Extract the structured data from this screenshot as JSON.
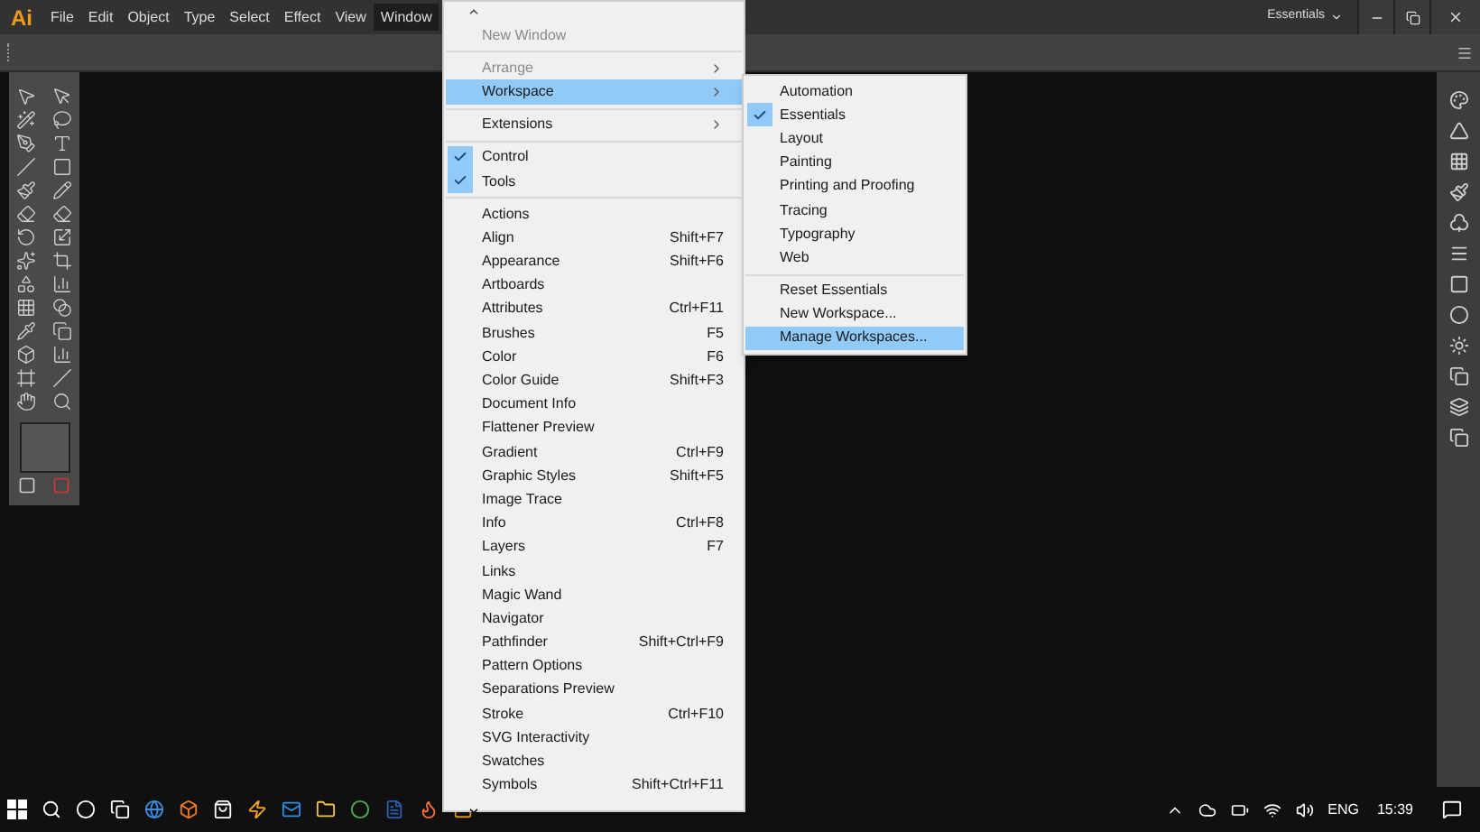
{
  "menubar": {
    "logo": "Ai",
    "menus": [
      {
        "label": "File",
        "selected": false
      },
      {
        "label": "Edit",
        "selected": false
      },
      {
        "label": "Object",
        "selected": false
      },
      {
        "label": "Type",
        "selected": false
      },
      {
        "label": "Select",
        "selected": false
      },
      {
        "label": "Effect",
        "selected": false
      },
      {
        "label": "View",
        "selected": false
      },
      {
        "label": "Window",
        "selected": true
      }
    ],
    "workspace": "Essentials"
  },
  "window_menu": {
    "sections": [
      [
        {
          "label": "New Window",
          "checked": false,
          "selected": false,
          "disabled": true,
          "submenu": false
        }
      ],
      [
        {
          "label": "Arrange",
          "checked": false,
          "selected": false,
          "disabled": true,
          "submenu": true
        },
        {
          "label": "Workspace",
          "checked": false,
          "selected": true,
          "disabled": false,
          "submenu": true
        }
      ],
      [
        {
          "label": "Extensions",
          "checked": false,
          "selected": false,
          "disabled": false,
          "submenu": true
        }
      ],
      [
        {
          "label": "Control",
          "checked": true,
          "selected": false,
          "disabled": false,
          "submenu": false
        },
        {
          "label": "Tools",
          "checked": true,
          "selected": false,
          "disabled": false,
          "submenu": false
        }
      ],
      [
        {
          "label": "Actions",
          "checked": false,
          "selected": false,
          "disabled": false,
          "submenu": false
        },
        {
          "label": "Align",
          "shortcut": "Shift+F7",
          "checked": false,
          "selected": false,
          "disabled": false,
          "submenu": false
        },
        {
          "label": "Appearance",
          "shortcut": "Shift+F6",
          "checked": false,
          "selected": false,
          "disabled": false,
          "submenu": false
        },
        {
          "label": "Artboards",
          "checked": false,
          "selected": false,
          "disabled": false,
          "submenu": false
        },
        {
          "label": "Attributes",
          "shortcut": "Ctrl+F11",
          "checked": false,
          "selected": false,
          "disabled": false,
          "submenu": false
        },
        {
          "label": "Brushes",
          "shortcut": "F5",
          "checked": false,
          "selected": false,
          "disabled": false,
          "submenu": false
        },
        {
          "label": "Color",
          "shortcut": "F6",
          "checked": false,
          "selected": false,
          "disabled": false,
          "submenu": false
        },
        {
          "label": "Color Guide",
          "shortcut": "Shift+F3",
          "checked": false,
          "selected": false,
          "disabled": false,
          "submenu": false
        },
        {
          "label": "Document Info",
          "checked": false,
          "selected": false,
          "disabled": false,
          "submenu": false
        },
        {
          "label": "Flattener Preview",
          "checked": false,
          "selected": false,
          "disabled": false,
          "submenu": false
        },
        {
          "label": "Gradient",
          "shortcut": "Ctrl+F9",
          "checked": false,
          "selected": false,
          "disabled": false,
          "submenu": false
        },
        {
          "label": "Graphic Styles",
          "shortcut": "Shift+F5",
          "checked": false,
          "selected": false,
          "disabled": false,
          "submenu": false
        },
        {
          "label": "Image Trace",
          "checked": false,
          "selected": false,
          "disabled": false,
          "submenu": false
        },
        {
          "label": "Info",
          "shortcut": "Ctrl+F8",
          "checked": false,
          "selected": false,
          "disabled": false,
          "submenu": false
        },
        {
          "label": "Layers",
          "shortcut": "F7",
          "checked": false,
          "selected": false,
          "disabled": false,
          "submenu": false
        },
        {
          "label": "Links",
          "checked": false,
          "selected": false,
          "disabled": false,
          "submenu": false
        },
        {
          "label": "Magic Wand",
          "checked": false,
          "selected": false,
          "disabled": false,
          "submenu": false
        },
        {
          "label": "Navigator",
          "checked": false,
          "selected": false,
          "disabled": false,
          "submenu": false
        },
        {
          "label": "Pathfinder",
          "shortcut": "Shift+Ctrl+F9",
          "checked": false,
          "selected": false,
          "disabled": false,
          "submenu": false
        },
        {
          "label": "Pattern Options",
          "checked": false,
          "selected": false,
          "disabled": false,
          "submenu": false
        },
        {
          "label": "Separations Preview",
          "checked": false,
          "selected": false,
          "disabled": false,
          "submenu": false
        },
        {
          "label": "Stroke",
          "shortcut": "Ctrl+F10",
          "checked": false,
          "selected": false,
          "disabled": false,
          "submenu": false
        },
        {
          "label": "SVG Interactivity",
          "checked": false,
          "selected": false,
          "disabled": false,
          "submenu": false
        },
        {
          "label": "Swatches",
          "checked": false,
          "selected": false,
          "disabled": false,
          "submenu": false
        },
        {
          "label": "Symbols",
          "shortcut": "Shift+Ctrl+F11",
          "checked": false,
          "selected": false,
          "disabled": false,
          "submenu": false
        }
      ]
    ]
  },
  "workspace_submenu": {
    "sections": [
      [
        {
          "label": "Automation",
          "checked": false,
          "selected": false
        },
        {
          "label": "Essentials",
          "checked": true,
          "selected": false
        },
        {
          "label": "Layout",
          "checked": false,
          "selected": false
        },
        {
          "label": "Painting",
          "checked": false,
          "selected": false
        },
        {
          "label": "Printing and Proofing",
          "checked": false,
          "selected": false
        },
        {
          "label": "Tracing",
          "checked": false,
          "selected": false
        },
        {
          "label": "Typography",
          "checked": false,
          "selected": false
        },
        {
          "label": "Web",
          "checked": false,
          "selected": false
        }
      ],
      [
        {
          "label": "Reset Essentials",
          "checked": false,
          "selected": false
        },
        {
          "label": "New Workspace...",
          "checked": false,
          "selected": false
        },
        {
          "label": "Manage Workspaces...",
          "checked": false,
          "selected": true
        }
      ]
    ]
  },
  "taskbar": {
    "language": "ENG",
    "time": "15:39"
  }
}
